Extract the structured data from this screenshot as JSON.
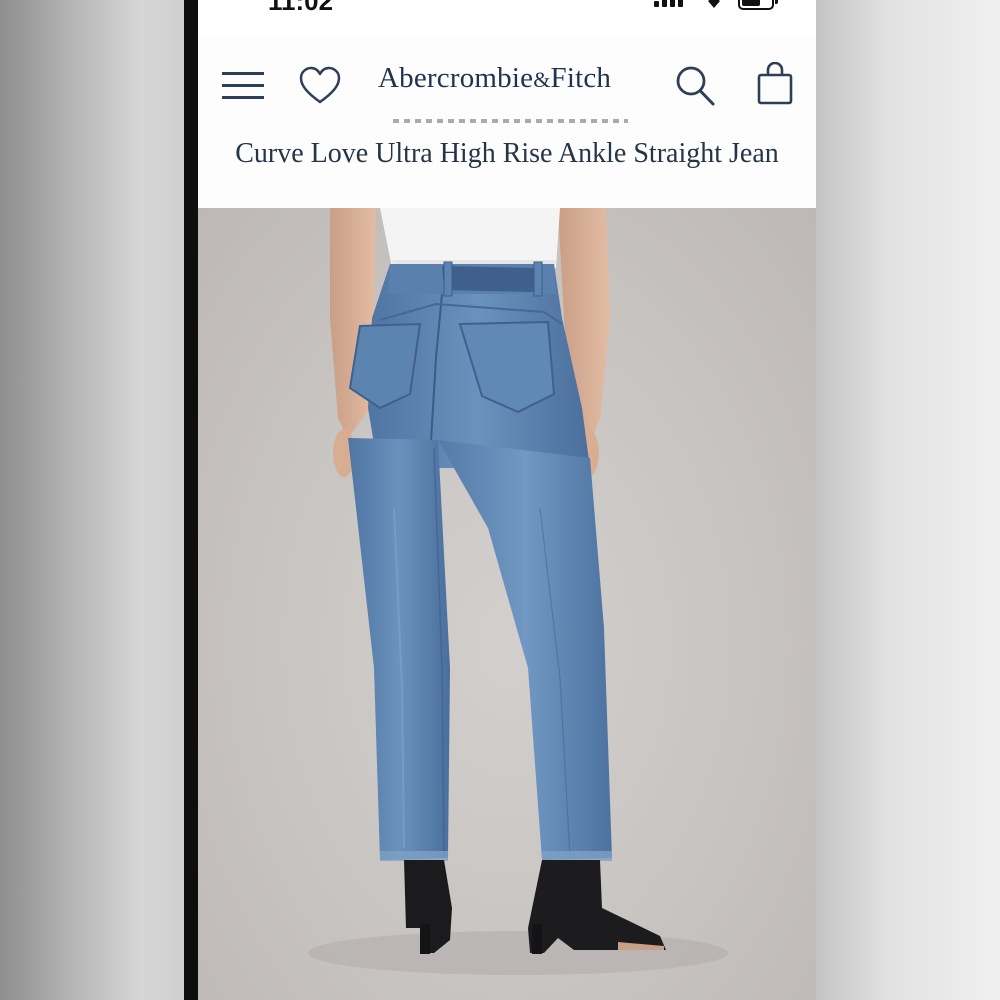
{
  "status_bar": {
    "time": "11:02"
  },
  "header": {
    "brand_main": "Abercrombie",
    "brand_amp": "&",
    "brand_end": "Fitch",
    "icons": [
      "menu-icon",
      "heart-icon",
      "search-icon",
      "bag-icon"
    ]
  },
  "product": {
    "title": "Curve Love Ultra High Rise Ankle Straight Jean"
  },
  "colors": {
    "brand_navy": "#1f3350",
    "denim": "#5c84b0",
    "background_gray": "#c8c4c2"
  }
}
